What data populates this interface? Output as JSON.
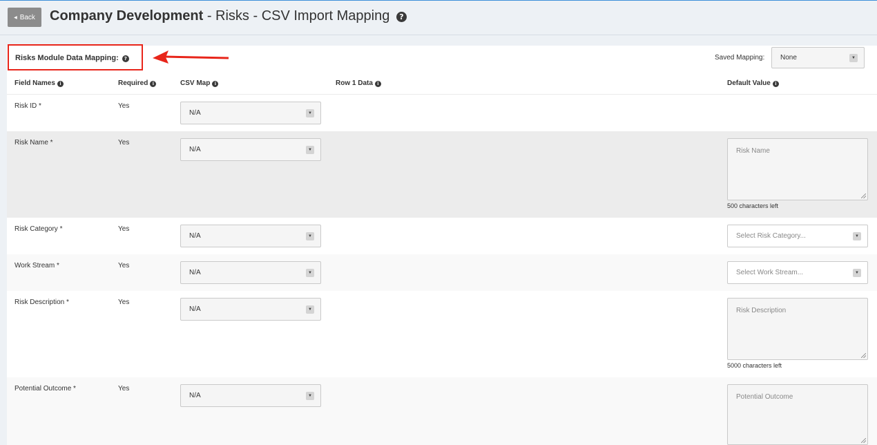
{
  "header": {
    "back_label": "Back",
    "company": "Company Development",
    "title_rest": " - Risks - CSV Import Mapping"
  },
  "mapping": {
    "heading": "Risks Module Data Mapping:",
    "saved_label": "Saved Mapping:",
    "saved_value": "None"
  },
  "columns": {
    "field_names": "Field Names",
    "required": "Required",
    "csv_map": "CSV Map",
    "row1_data": "Row 1 Data",
    "default_value": "Default Value"
  },
  "rows": [
    {
      "field": "Risk ID *",
      "required": "Yes",
      "csv_map": "N/A"
    },
    {
      "field": "Risk Name *",
      "required": "Yes",
      "csv_map": "N/A",
      "default_placeholder": "Risk Name",
      "chars_left": "500 characters left"
    },
    {
      "field": "Risk Category *",
      "required": "Yes",
      "csv_map": "N/A",
      "default_select": "Select Risk Category..."
    },
    {
      "field": "Work Stream *",
      "required": "Yes",
      "csv_map": "N/A",
      "default_select": "Select Work Stream..."
    },
    {
      "field": "Risk Description *",
      "required": "Yes",
      "csv_map": "N/A",
      "default_placeholder": "Risk Description",
      "chars_left": "5000 characters left"
    },
    {
      "field": "Potential Outcome *",
      "required": "Yes",
      "csv_map": "N/A",
      "default_placeholder": "Potential Outcome"
    }
  ],
  "colors": {
    "accent_red": "#e8251a",
    "header_bg": "#edf1f5",
    "back_button": "#8c8c8c"
  }
}
